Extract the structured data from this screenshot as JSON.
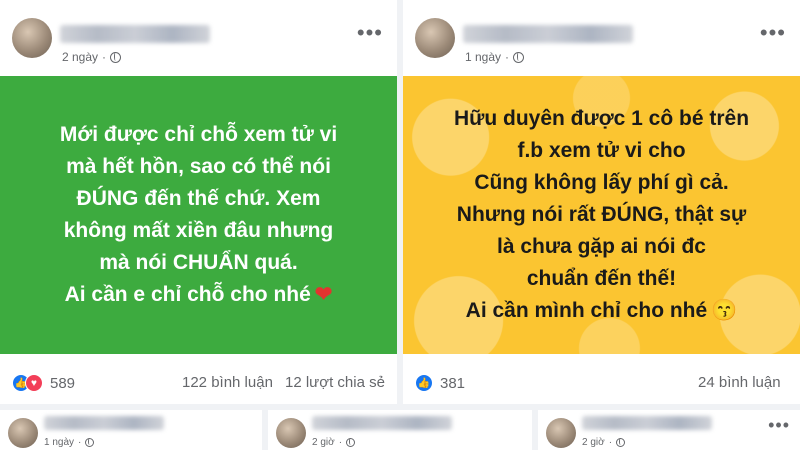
{
  "posts": [
    {
      "time": "2 ngày",
      "lines": [
        "Mới được chỉ chỗ xem tử vi",
        "mà hết hồn, sao có thể nói",
        "ĐÚNG đến thế chứ. Xem",
        "không mất xiền đâu nhưng",
        "mà nói CHUẨN quá.",
        "Ai cần e chỉ chỗ cho nhé"
      ],
      "emoji": "❤",
      "reactions": "589",
      "comments": "122 bình luận",
      "shares": "12 lượt chia sẻ"
    },
    {
      "time": "1 ngày",
      "lines": [
        "Hữu duyên được 1 cô bé trên",
        "f.b xem tử vi cho",
        "Cũng không lấy phí gì cả.",
        "Nhưng nói rất ĐÚNG, thật sự",
        "là chưa gặp ai nói đc",
        "chuẩn đến thế!",
        "Ai cần mình chỉ cho nhé"
      ],
      "emoji": "😙",
      "reactions": "381",
      "comments": "24 bình luận"
    }
  ],
  "mini_posts": [
    {
      "time": "1 ngày"
    },
    {
      "time": "2 giờ"
    },
    {
      "time": "2 giờ"
    }
  ],
  "colors": {
    "left_card_bg": "#3dab3f",
    "right_card_bg": "#fbc531",
    "like": "#1877f2",
    "love": "#f33e58"
  },
  "icons": {
    "more": "more-icon",
    "privacy": "globe-icon",
    "like": "like-icon",
    "love": "love-icon"
  }
}
